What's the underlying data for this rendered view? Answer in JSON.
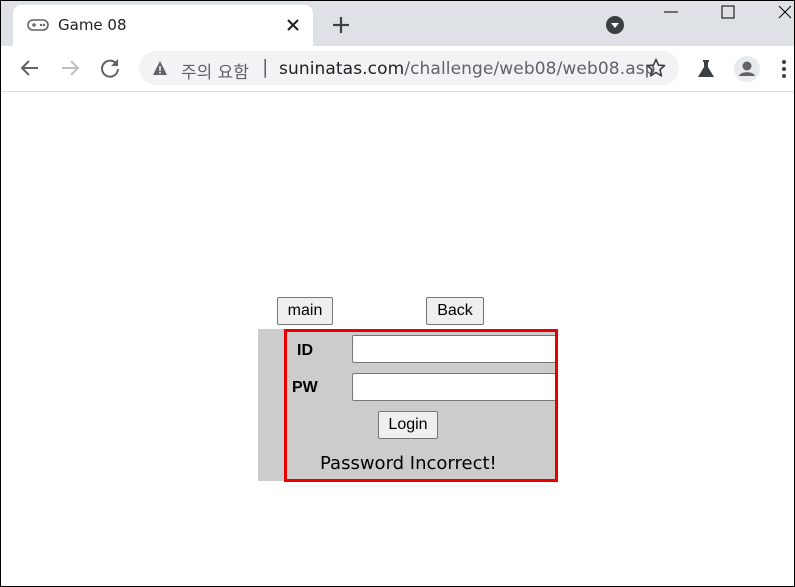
{
  "browser": {
    "tab_title": "Game 08",
    "tab_icon": "gamepad-icon",
    "security_warning": "주의 요함",
    "url_separator": "|",
    "url_host": "suninatas.com",
    "url_path": "/challenge/web08/web08.asp"
  },
  "page": {
    "main_button": "main",
    "back_button": "Back",
    "id_label": "ID",
    "pw_label": "PW",
    "id_value": "",
    "pw_value": "",
    "login_button": "Login",
    "message": "Password Incorrect!"
  },
  "colors": {
    "highlight": "#e60000",
    "form_background": "#cccccc",
    "tabstrip": "#dee1e6"
  }
}
